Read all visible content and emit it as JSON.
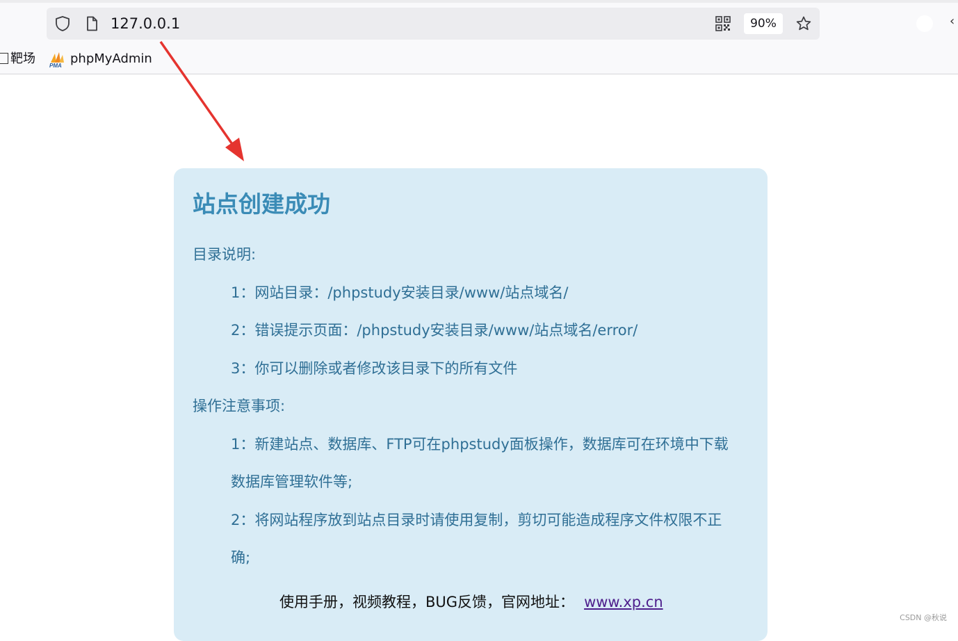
{
  "browser": {
    "url": "127.0.0.1",
    "zoom": "90%",
    "bookmarks": [
      {
        "label": "靶场",
        "icon": "folder-icon"
      },
      {
        "label": "phpMyAdmin",
        "icon": "pma-logo"
      }
    ]
  },
  "page": {
    "title": "站点创建成功",
    "section1_heading": "目录说明:",
    "section1_items": [
      "1：网站目录：/phpstudy安装目录/www/站点域名/",
      "2：错误提示页面：/phpstudy安装目录/www/站点域名/error/",
      "3：你可以删除或者修改该目录下的所有文件"
    ],
    "section2_heading": "操作注意事项:",
    "section2_items": [
      {
        "line1": "1：新建站点、数据库、FTP可在phpstudy面板操作，数据库可在环境中下载",
        "line2": "数据库管理软件等;"
      },
      {
        "line1": "2：将网站程序放到站点目录时请使用复制，剪切可能造成程序文件权限不正",
        "line2": "确;"
      }
    ],
    "footer_text": "使用手册，视频教程，BUG反馈，官网地址：",
    "footer_link": "www.xp.cn"
  },
  "watermark": "CSDN @秋说",
  "colors": {
    "card_bg": "#d9ecf6",
    "card_text": "#2f6f95",
    "title": "#3a8bb6",
    "arrow": "#e5342f",
    "link": "#4e1f8c"
  }
}
